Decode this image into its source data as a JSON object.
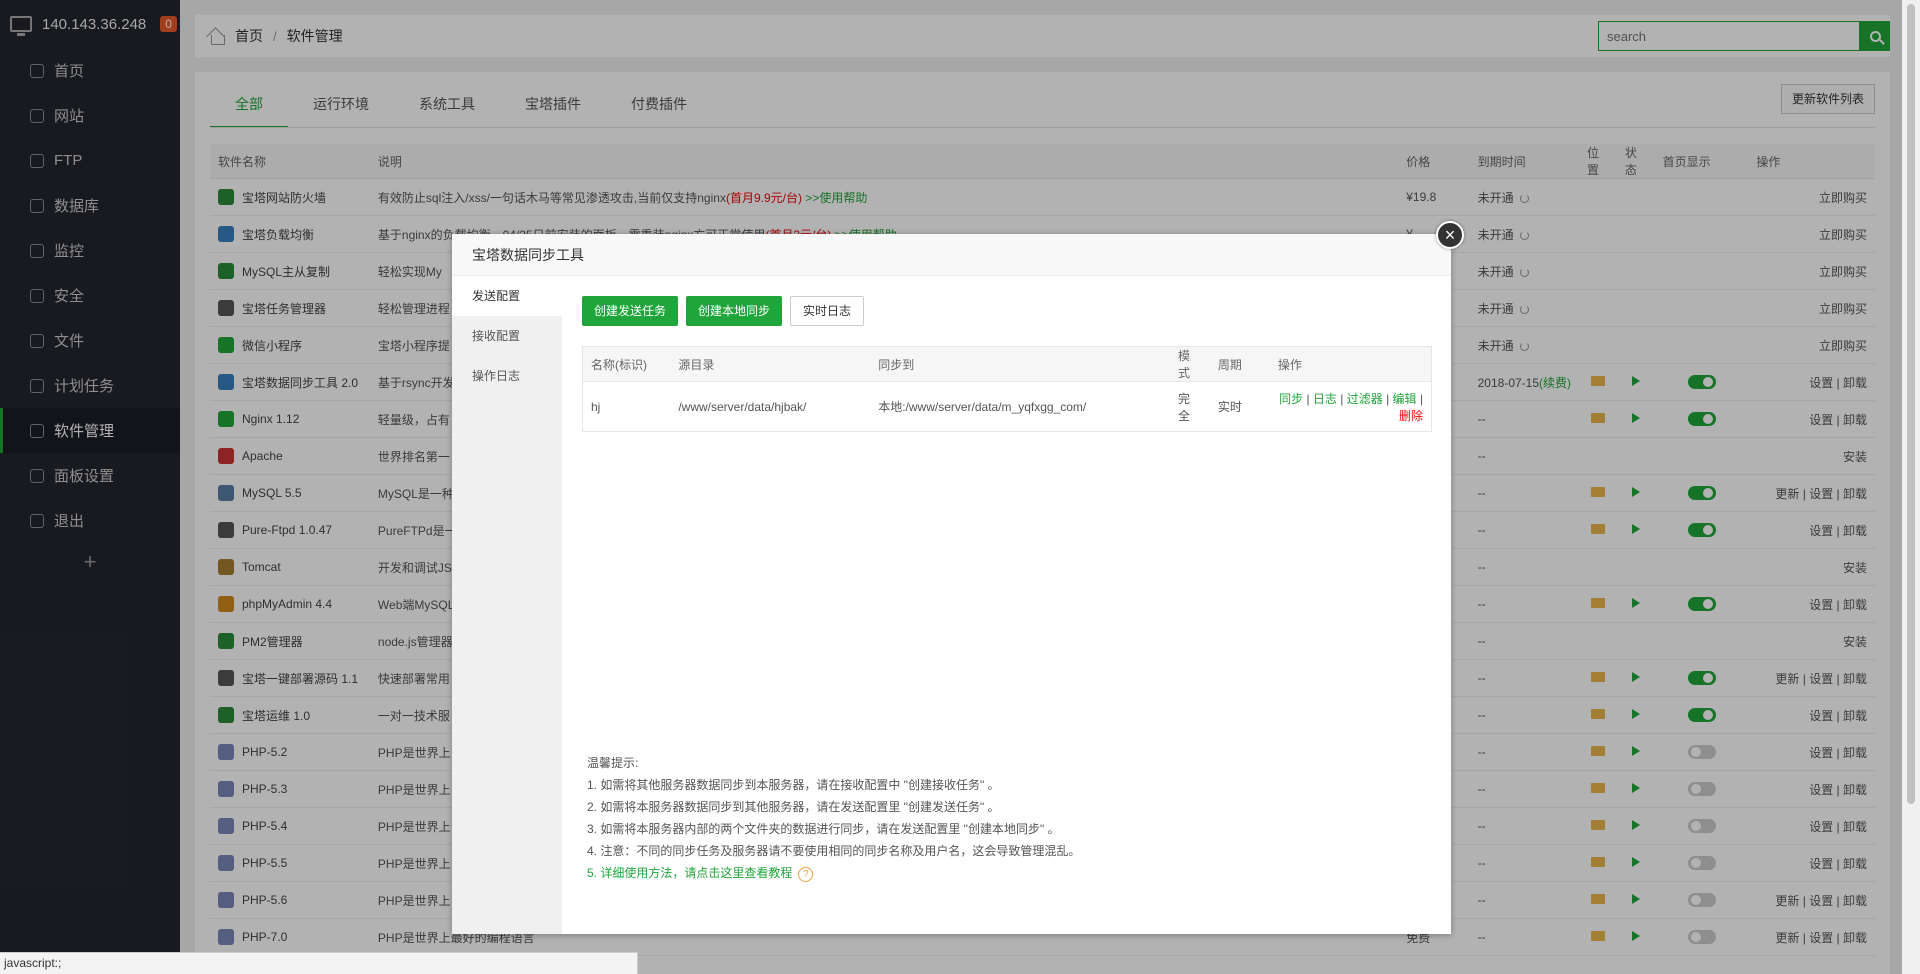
{
  "sidebar": {
    "ip": "140.143.36.248",
    "badge": "0",
    "items": [
      {
        "label": "首页",
        "icon": "home-icon"
      },
      {
        "label": "网站",
        "icon": "globe-icon"
      },
      {
        "label": "FTP",
        "icon": "ftp-icon"
      },
      {
        "label": "数据库",
        "icon": "database-icon"
      },
      {
        "label": "监控",
        "icon": "monitor-icon"
      },
      {
        "label": "安全",
        "icon": "shield-icon"
      },
      {
        "label": "文件",
        "icon": "folder-icon"
      },
      {
        "label": "计划任务",
        "icon": "calendar-icon"
      },
      {
        "label": "软件管理",
        "icon": "grid-icon"
      },
      {
        "label": "面板设置",
        "icon": "gear-icon"
      },
      {
        "label": "退出",
        "icon": "logout-icon"
      }
    ],
    "add": "+"
  },
  "breadcrumb": {
    "home": "首页",
    "sep": "/",
    "current": "软件管理"
  },
  "search": {
    "placeholder": "search"
  },
  "tabs": [
    "全部",
    "运行环境",
    "系统工具",
    "宝塔插件",
    "付费插件"
  ],
  "refresh_label": "更新软件列表",
  "table": {
    "headers": [
      "软件名称",
      "说明",
      "价格",
      "到期时间",
      "位置",
      "状态",
      "首页显示",
      "操作"
    ],
    "rows": [
      {
        "name": "宝塔网站防火墙",
        "desc": "有效防止sql注入/xss/一句话木马等常见渗透攻击,当前仅支持nginx",
        "desc_red": "(首月9.9元/台)",
        "desc_link": " >>使用帮助",
        "price": "¥19.8",
        "expire": "未开通",
        "action": "立即购买"
      },
      {
        "name": "宝塔负载均衡",
        "desc": "基于nginx的负载均衡，04/25日前安装的面板，需重装nginx方可正常使用",
        "desc_red": "(首月3元/台)",
        "desc_link": " >>使用帮助",
        "price": "¥",
        "expire": "未开通",
        "action": "立即购买"
      },
      {
        "name": "MySQL主从复制",
        "desc": "轻松实现My",
        "price": "",
        "expire": "未开通",
        "action": "立即购买"
      },
      {
        "name": "宝塔任务管理器",
        "desc": "轻松管理进程",
        "price": "",
        "expire": "未开通",
        "action": "立即购买"
      },
      {
        "name": "微信小程序",
        "desc": "宝塔小程序提",
        "price": "",
        "expire": "未开通",
        "action": "立即购买"
      },
      {
        "name": "宝塔数据同步工具 2.0",
        "desc": "基于rsync开发",
        "price": "",
        "expire": "2018-07-15",
        "expire2": "(续费)",
        "folder": true,
        "play": true,
        "switch": "on",
        "action": "设置 | 卸载"
      },
      {
        "name": "Nginx 1.12",
        "desc": "轻量级，占有",
        "price": "",
        "expire": "--",
        "folder": true,
        "play": true,
        "switch": "on",
        "action": "设置 | 卸载"
      },
      {
        "name": "Apache",
        "desc": "世界排名第一",
        "price": "",
        "expire": "--",
        "action": "安装"
      },
      {
        "name": "MySQL 5.5",
        "desc": "MySQL是一种",
        "price": "",
        "expire": "--",
        "folder": true,
        "play": true,
        "switch": "on",
        "action": "更新 | 设置 | 卸载"
      },
      {
        "name": "Pure-Ftpd 1.0.47",
        "desc": "PureFTPd是一",
        "price": "",
        "expire": "--",
        "folder": true,
        "play": true,
        "switch": "on",
        "action": "设置 | 卸载"
      },
      {
        "name": "Tomcat",
        "desc": "开发和调试JS",
        "price": "",
        "expire": "--",
        "action": "安装"
      },
      {
        "name": "phpMyAdmin 4.4",
        "desc": "Web端MySQL",
        "price": "",
        "expire": "--",
        "folder": true,
        "play": true,
        "switch": "on",
        "action": "设置 | 卸载"
      },
      {
        "name": "PM2管理器",
        "desc": "node.js管理器",
        "price": "",
        "expire": "--",
        "action": "安装"
      },
      {
        "name": "宝塔一键部署源码 1.1",
        "desc": "快速部署常用",
        "price": "",
        "expire": "--",
        "folder": true,
        "play": true,
        "switch": "on",
        "action": "更新 | 设置 | 卸载"
      },
      {
        "name": "宝塔运维 1.0",
        "desc": "一对一技术服",
        "price": "",
        "expire": "--",
        "folder": true,
        "play": true,
        "switch": "on",
        "action": "设置 | 卸载"
      },
      {
        "name": "PHP-5.2",
        "desc": "PHP是世界上",
        "price": "",
        "expire": "--",
        "folder": true,
        "play": true,
        "switch": "off",
        "action": "设置 | 卸载"
      },
      {
        "name": "PHP-5.3",
        "desc": "PHP是世界上",
        "price": "",
        "expire": "--",
        "folder": true,
        "play": true,
        "switch": "off",
        "action": "设置 | 卸载"
      },
      {
        "name": "PHP-5.4",
        "desc": "PHP是世界上",
        "price": "",
        "expire": "--",
        "folder": true,
        "play": true,
        "switch": "off",
        "action": "设置 | 卸载"
      },
      {
        "name": "PHP-5.5",
        "desc": "PHP是世界上",
        "price": "",
        "expire": "--",
        "folder": true,
        "play": true,
        "switch": "off",
        "action": "设置 | 卸载"
      },
      {
        "name": "PHP-5.6",
        "desc": "PHP是世界上",
        "price": "",
        "expire": "--",
        "folder": true,
        "play": true,
        "switch": "off",
        "action": "更新 | 设置 | 卸载"
      },
      {
        "name": "PHP-7.0",
        "desc": "PHP是世界上最好的编程语言",
        "price": "免费",
        "expire": "--",
        "folder": true,
        "play": true,
        "switch": "off",
        "action": "更新 | 设置 | 卸载"
      }
    ]
  },
  "modal": {
    "title": "宝塔数据同步工具",
    "close": "×",
    "side": [
      "发送配置",
      "接收配置",
      "操作日志"
    ],
    "buttons": {
      "create_send": "创建发送任务",
      "create_local": "创建本地同步",
      "log": "实时日志"
    },
    "sync_headers": [
      "名称(标识)",
      "源目录",
      "同步到",
      "模式",
      "周期",
      "操作"
    ],
    "sync_row": {
      "name": "hj",
      "source": "/www/server/data/hjbak/",
      "target": "本地:/www/server/data/m_yqfxgg_com/",
      "mode": "完全",
      "cycle": "实时",
      "ops": [
        "同步",
        "日志",
        "过滤器",
        "编辑"
      ],
      "delete": "删除"
    },
    "tips": {
      "title": "温馨提示:",
      "lines": [
        "1. 如需将其他服务器数据同步到本服务器，请在接收配置中 \"创建接收任务\" 。",
        "2. 如需将本服务器数据同步到其他服务器，请在发送配置里 \"创建发送任务\" 。",
        "3. 如需将本服务器内部的两个文件夹的数据进行同步，请在发送配置里 \"创建本地同步\" 。",
        "4. 注意：不同的同步任务及服务器请不要使用相同的同步名称及用户名，这会导致管理混乱。"
      ],
      "link": "5. 详细使用方法，请点击这里查看教程",
      "help": "?"
    }
  },
  "statusbar": "javascript:;"
}
